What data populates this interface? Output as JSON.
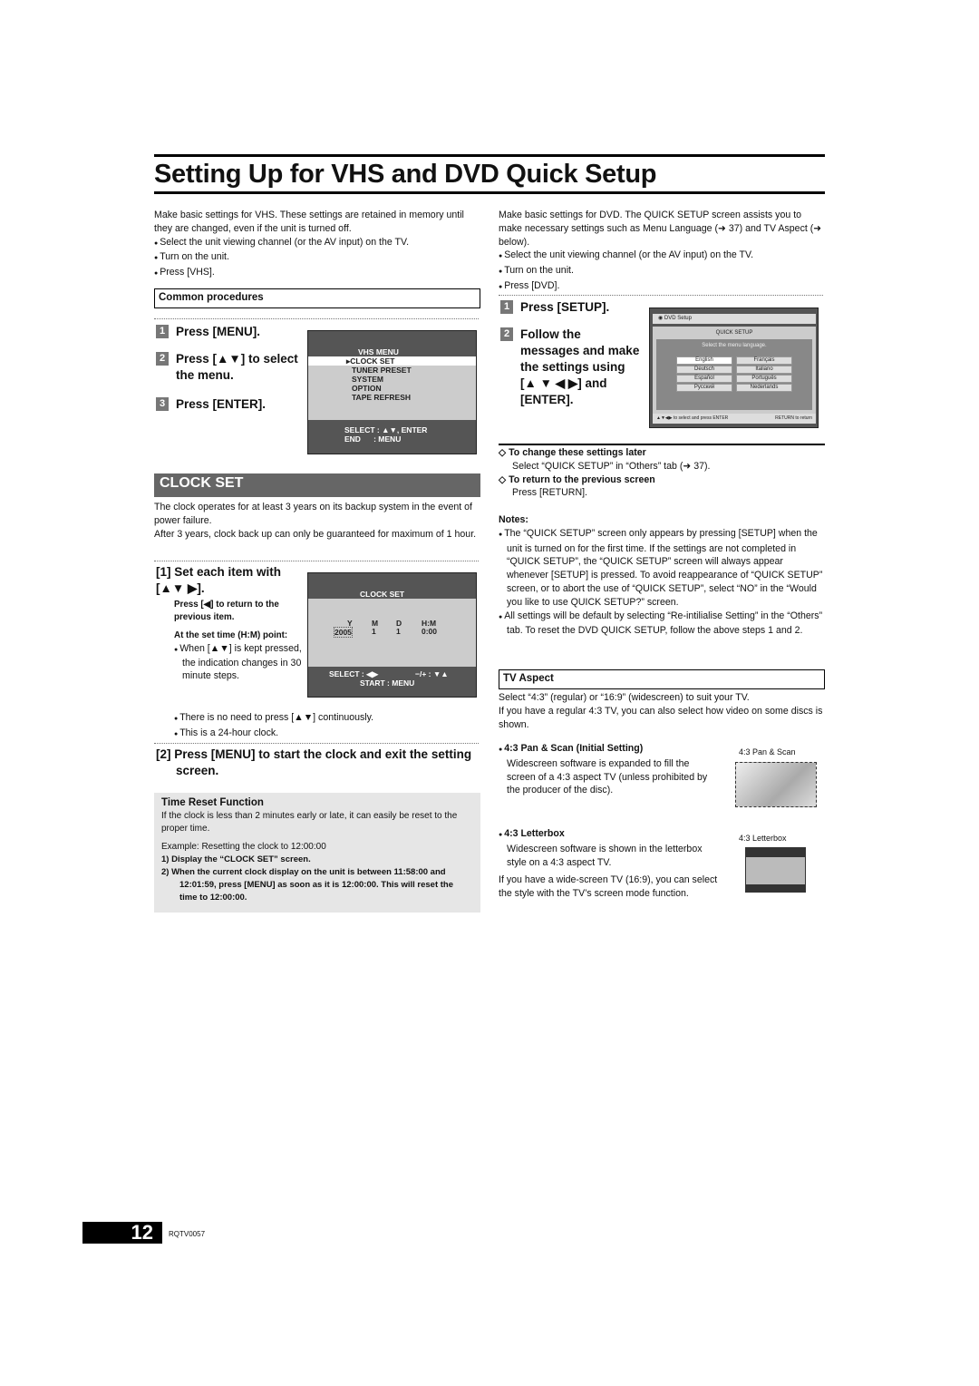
{
  "title": "Setting Up for VHS and DVD Quick Setup",
  "left": {
    "intro": "Make basic settings for VHS. These settings are retained in memory until they are changed, even if the unit is turned off.",
    "bullets": [
      "Select the unit viewing channel (or the AV input) on the TV.",
      "Turn on the unit.",
      "Press [VHS]."
    ],
    "common_procedures": "Common procedures",
    "steps": [
      {
        "n": "1",
        "label": "Press [MENU]."
      },
      {
        "n": "2",
        "label": "Press [▲▼] to select the menu."
      },
      {
        "n": "3",
        "label": "Press [ENTER]."
      }
    ],
    "vhs_screen": {
      "title": "VHS MENU",
      "items": [
        "CLOCK SET",
        "TUNER PRESET",
        "SYSTEM",
        "OPTION",
        "TAPE REFRESH"
      ],
      "footer1": "SELECT : ▲▼, ENTER",
      "footer2": "END      : MENU"
    },
    "clock_set_heading": "CLOCK SET",
    "clock_p1": "The clock operates for at least 3 years on its backup system in the event of power failure.",
    "clock_p2": "After 3 years, clock back up can only be guaranteed for maximum of 1 hour.",
    "step1": "[1] Set each item with [▲▼ ▶].",
    "press_back": "Press [◀] to return to the previous item.",
    "at_set_time": "At the set time (H:M) point:",
    "when_kept": "When [▲▼] is kept pressed, the indication changes in 30 minute steps.",
    "no_need": "There is no need to press [▲▼] continuously.",
    "hour24": "This is a 24-hour clock.",
    "clock_screen": {
      "title": "CLOCK SET",
      "headers": [
        "Y",
        "M",
        "D",
        "H:M"
      ],
      "values": [
        "2005",
        "1",
        "1",
        "0:00"
      ],
      "select": "SELECT : ◀▶",
      "plusminus": "−/+ : ▼▲",
      "start": "START : MENU"
    },
    "step2": "[2] Press [MENU] to start the clock and exit the setting screen.",
    "time_reset": {
      "title": "Time Reset Function",
      "text": "If the clock is less than 2 minutes early or late, it can easily be reset to the proper time.",
      "example": "Example: Resetting the clock to 12:00:00",
      "s1": "1)  Display the “CLOCK SET” screen.",
      "s2": "2)  When the current clock display on the unit is between 11:58:00 and 12:01:59, press [MENU] as soon as it is 12:00:00. This will reset the time to 12:00:00."
    }
  },
  "right": {
    "intro": "Make basic settings for DVD. The QUICK SETUP screen assists you to make necessary settings such as Menu Language (➜ 37) and TV Aspect (➜ below).",
    "bullets": [
      "Select the unit viewing channel (or the AV input) on the TV.",
      "Turn on the unit.",
      "Press [DVD]."
    ],
    "steps": [
      {
        "n": "1",
        "label": "Press [SETUP]."
      },
      {
        "n": "2",
        "label": "Follow the messages and make the settings using [▲ ▼ ◀ ▶] and [ENTER]."
      }
    ],
    "dvd_screen": {
      "header": "DVD Setup",
      "title": "QUICK SETUP",
      "prompt": "Select the menu language.",
      "langs": [
        "English",
        "Français",
        "Deutsch",
        "Italiano",
        "Español",
        "Português",
        "Русский",
        "Nederlands"
      ],
      "footer_left": "▲▼◀▶ to select and press ENTER",
      "footer_right": "RETURN to return"
    },
    "change_later_title": "To change these settings later",
    "change_later": "Select “QUICK SETUP” in “Others” tab (➜ 37).",
    "return_title": "To return to the previous screen",
    "return_text": "Press [RETURN].",
    "notes_title": "Notes:",
    "notes": [
      "The “QUICK SETUP” screen only appears by pressing [SETUP] when the unit is turned on for the first time. If the settings are not completed in “QUICK SETUP”, the “QUICK SETUP” screen will always appear whenever [SETUP] is pressed. To avoid reappearance of “QUICK SETUP” screen, or to abort the use of “QUICK SETUP”, select “NO” in the “Would you like to use QUICK SETUP?” screen.",
      "All settings will be default by selecting “Re-intilialise Setting” in the “Others” tab. To reset the DVD QUICK SETUP, follow the above steps 1 and 2."
    ],
    "tv_aspect": "TV Aspect",
    "tv_text1": "Select “4:3” (regular) or “16:9” (widescreen) to suit your TV.",
    "tv_text2": "If you have a regular 4:3 TV, you can also select how video on some discs is shown.",
    "panscan_title": "4:3 Pan & Scan (Initial Setting)",
    "panscan_text": "Widescreen software is expanded to fill the screen of a 4:3 aspect TV (unless prohibited by the producer of the disc).",
    "panscan_caption": "4:3 Pan & Scan",
    "letterbox_title": "4:3 Letterbox",
    "letterbox_text": "Widescreen software is shown in the letterbox style on a 4:3 aspect TV.",
    "letterbox_caption": "4:3 Letterbox",
    "wide_text": "If you have a wide-screen TV (16:9), you can select the style with the TV’s screen mode function."
  },
  "footer": {
    "page": "12",
    "code": "RQTV0057"
  }
}
